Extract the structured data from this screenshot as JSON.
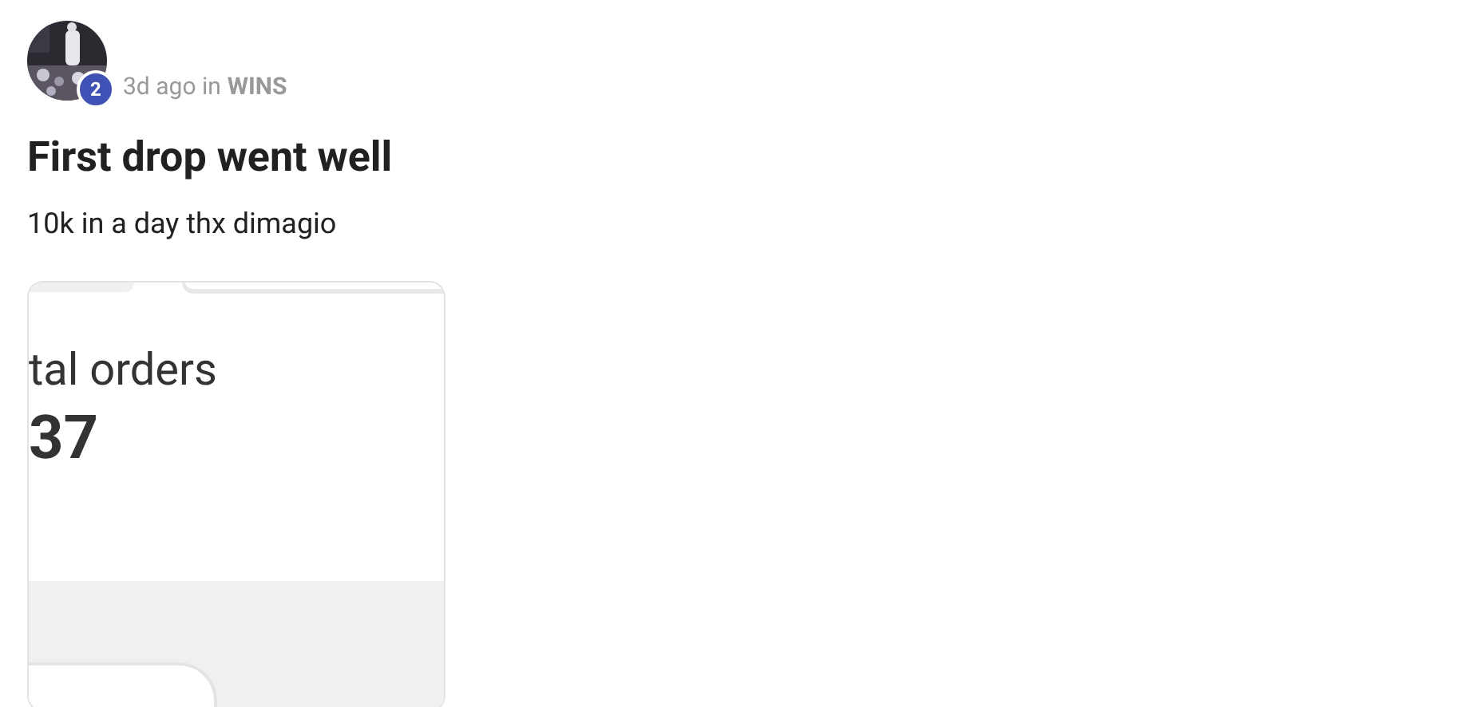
{
  "post": {
    "badge": "2",
    "time": "3d ago in",
    "category": "WINS",
    "title": "First drop went well",
    "body": "10k in a day thx dimagio",
    "attachment": {
      "label": "tal orders",
      "value": "37"
    }
  }
}
